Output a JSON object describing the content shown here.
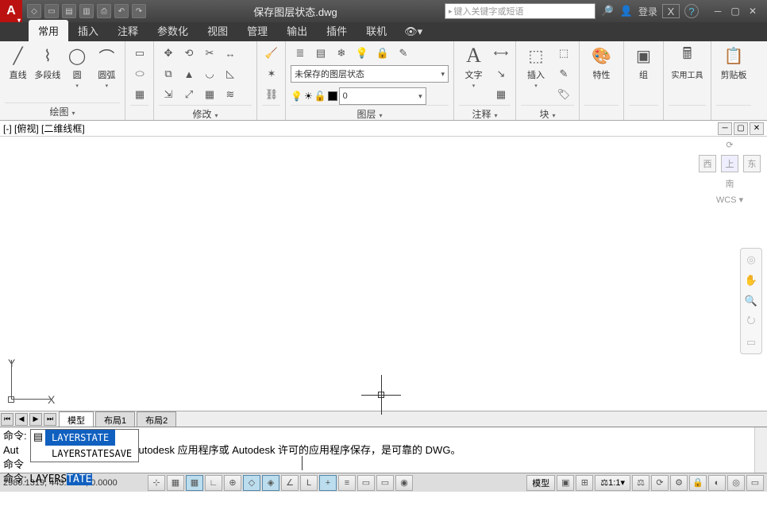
{
  "title": "保存图层状态.dwg",
  "search_placeholder": "键入关键字或短语",
  "login_label": "登录",
  "ribbon_tabs": [
    "常用",
    "插入",
    "注释",
    "参数化",
    "视图",
    "管理",
    "输出",
    "插件",
    "联机"
  ],
  "active_tab": 0,
  "panels": {
    "draw": {
      "label": "绘图",
      "btns": [
        "直线",
        "多段线",
        "圆",
        "圆弧"
      ]
    },
    "modify": {
      "label": "修改"
    },
    "layer": {
      "label": "图层",
      "state_combo": "未保存的图层状态",
      "layer_combo_value": "0"
    },
    "annot": {
      "label": "注释",
      "btn": "文字"
    },
    "block": {
      "label": "块",
      "btn": "插入"
    },
    "props": {
      "label": "特性"
    },
    "group": {
      "label": "组"
    },
    "util": {
      "label": "实用工具"
    },
    "clip": {
      "label": "剪贴板"
    }
  },
  "view_label": "[-] [俯视] [二维线框]",
  "viewcube": {
    "top": "上",
    "w": "西",
    "n": "南",
    "wcs": "WCS"
  },
  "layout_tabs": [
    "模型",
    "布局1",
    "布局2"
  ],
  "command": {
    "line1_prefix": "命令:",
    "line2_prefix": "Aut",
    "line2_rest": "件上次由 Autodesk 应用程序或 Autodesk 许可的应用程序保存，是可靠的 DWG。",
    "line3": "命令",
    "prompt": "命令: ",
    "typed_plain": "LAYERS",
    "typed_sel": "TATE",
    "autocomplete": [
      "LAYERSTATE",
      "LAYERSTATESAVE"
    ],
    "ac_selected": 0
  },
  "status": {
    "coords": "2980.1319, 443.9671, 0.0000",
    "model_label": "模型",
    "scale": "1:1"
  }
}
